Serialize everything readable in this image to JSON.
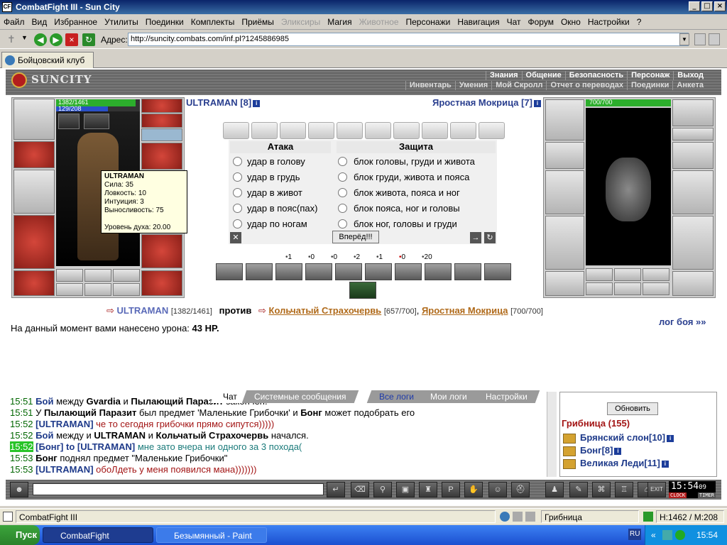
{
  "window": {
    "title": "CombatFight III - Sun City"
  },
  "menu": [
    "Файл",
    "Вид",
    "Избранное",
    "Утилиты",
    "Поединки",
    "Комплекты",
    "Приёмы",
    "Эликсиры",
    "Магия",
    "Животное",
    "Персонажи",
    "Навигация",
    "Чат",
    "Форум",
    "Окно",
    "Настройки",
    "?"
  ],
  "menu_disabled": [
    "Эликсиры",
    "Животное"
  ],
  "address": {
    "label": "Адрес:",
    "url": "http://suncity.combats.com/inf.pl?1245886985"
  },
  "tab": {
    "label": "Бойцовский клуб"
  },
  "site": {
    "logo": "SUNCITY",
    "nav_top": [
      "Знания",
      "Общение",
      "Безопасность",
      "Персонаж",
      "Выход"
    ],
    "nav_bottom": [
      "Инвентарь",
      "Умения",
      "Мой Скролл",
      "Отчет о переводах",
      "Поединки",
      "Анкета"
    ]
  },
  "player": {
    "hp": "1382/1461",
    "hp_fraction": 0.946,
    "mana": "129/208",
    "mana_fraction": 0.62,
    "name": "ULTRAMAN [8]",
    "tooltip": {
      "name": "ULTRAMAN",
      "lines": [
        "Сила: 35",
        "Ловкость: 10",
        "Интуиция: 3",
        "Выносливость: 75"
      ],
      "spirit": "Уровень духа: 20.00"
    },
    "equipment": [
      "helmet",
      "amulet",
      "bracers",
      "hammer",
      "armor",
      "belt",
      "shoulders",
      "gloves",
      "leggings",
      "boots",
      "rings"
    ]
  },
  "enemy": {
    "name": "Яростная Мокрица [7]",
    "hp": "700/700",
    "hp_fraction": 1.0,
    "equipment": [
      "helmet",
      "earrings",
      "bracers",
      "sword",
      "armor",
      "belt",
      "gloves",
      "shield",
      "leggings",
      "boots"
    ]
  },
  "battle": {
    "attack_header": "Атака",
    "defense_header": "Защита",
    "attacks": [
      "удар в голову",
      "удар в грудь",
      "удар в живот",
      "удар в пояс(пах)",
      "удар по ногам"
    ],
    "defenses": [
      "блок головы, груди и живота",
      "блок груди, живота и пояса",
      "блок живота, пояса и ног",
      "блок пояса, ног и головы",
      "блок ног, головы и груди"
    ],
    "forward": "Вперёд!!!",
    "stats": [
      {
        "icon": "hit-icon",
        "v": "1"
      },
      {
        "icon": "drop-icon",
        "v": "0"
      },
      {
        "icon": "counter-icon",
        "v": "0"
      },
      {
        "icon": "block-icon",
        "v": "2"
      },
      {
        "icon": "cross-icon",
        "v": "1"
      },
      {
        "icon": "heart-icon",
        "v": "0"
      },
      {
        "icon": "shield-icon",
        "v": "20"
      }
    ]
  },
  "versus": {
    "p1": "ULTRAMAN",
    "p1_hp": "[1382/1461]",
    "vs": "против",
    "e1": "Кольчатый Страхочервь",
    "e1_hp": "[657/700]",
    "comma": ",",
    "e2": "Яростная Мокрица",
    "e2_hp": "[700/700]"
  },
  "damage": {
    "text": "На данный момент вами нанесено урона:",
    "value": "43 HP."
  },
  "loglink": "лог боя »»",
  "chat_tabs": [
    "Чат",
    "Системные сообщения",
    "Все логи",
    "Мои логи",
    "Настройки"
  ],
  "chat": [
    {
      "t": "15:51",
      "parts": [
        {
          "c": "bl",
          "x": "Бой"
        },
        {
          "c": "",
          "x": " между "
        },
        {
          "c": "b",
          "x": "Gvardia"
        },
        {
          "c": "",
          "x": " и "
        },
        {
          "c": "b",
          "x": "Пылающий Паразит"
        },
        {
          "c": "",
          "x": " закончен."
        }
      ]
    },
    {
      "t": "15:51",
      "parts": [
        {
          "c": "",
          "x": "У "
        },
        {
          "c": "b",
          "x": "Пылающий Паразит"
        },
        {
          "c": "",
          "x": " был предмет 'Маленькие Грибочки' и "
        },
        {
          "c": "b",
          "x": "Бонг"
        },
        {
          "c": "",
          "x": " может подобрать его"
        }
      ]
    },
    {
      "t": "15:52",
      "parts": [
        {
          "c": "bl",
          "x": "[ULTRAMAN]"
        },
        {
          "c": "rd",
          "x": " че то сегодня грибочки прямо сипутся)))))"
        }
      ]
    },
    {
      "t": "15:52",
      "parts": [
        {
          "c": "bl",
          "x": "Бой"
        },
        {
          "c": "",
          "x": " между и "
        },
        {
          "c": "b",
          "x": "ULTRAMAN"
        },
        {
          "c": "",
          "x": " и "
        },
        {
          "c": "b",
          "x": "Кольчатый Страхочервь"
        },
        {
          "c": "",
          "x": " начался."
        }
      ]
    },
    {
      "t": "15:52",
      "hl": true,
      "parts": [
        {
          "c": "bl",
          "x": "[Бонг]"
        },
        {
          "c": "bl",
          "x": " to [ULTRAMAN]"
        },
        {
          "c": "tl",
          "x": " мне зато вчера ни одного за 3 похода("
        }
      ]
    },
    {
      "t": "15:53",
      "parts": [
        {
          "c": "b",
          "x": "Бонг"
        },
        {
          "c": "",
          "x": " поднял предмет \"Маленькие Грибочки\""
        }
      ]
    },
    {
      "t": "15:53",
      "parts": [
        {
          "c": "bl",
          "x": "[ULTRAMAN]"
        },
        {
          "c": "rd",
          "x": " обоЛдеть у меня появился мана)))))))"
        }
      ]
    }
  ],
  "online": {
    "refresh": "Обновить",
    "room": "Грибница (155)",
    "users": [
      {
        "name": "Брянский слон",
        "lvl": "[10]"
      },
      {
        "name": "Бонг",
        "lvl": "[8]"
      },
      {
        "name": "Великая Леди",
        "lvl": "[11]"
      }
    ]
  },
  "clock": {
    "time": "15:54",
    "sec": "09",
    "label1": "CLOCK",
    "label2": "TIMER"
  },
  "exit_label": "EXIT",
  "status": {
    "left": "CombatFight III",
    "room": "Грибница",
    "coords": "H:1462 / M:208"
  },
  "taskbar": {
    "start": "Пуск",
    "tasks": [
      "CombatFight",
      "Безымянный - Paint"
    ],
    "lang": "RU",
    "time": "15:54"
  }
}
